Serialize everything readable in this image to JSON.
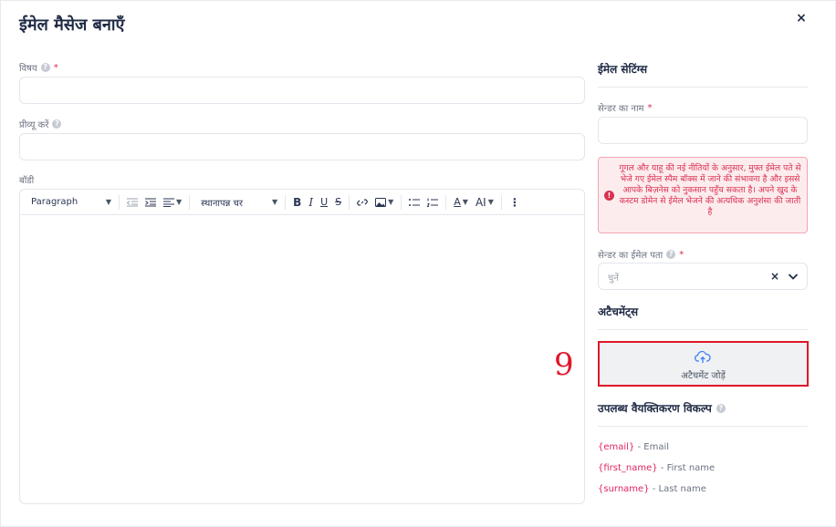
{
  "modal": {
    "title": "ईमेल मैसेज बनाएँ",
    "close_glyph": "×"
  },
  "form": {
    "subject_label": "विषय",
    "subject_value": "",
    "preview_label": "प्रीव्यू करें",
    "preview_value": "",
    "body_label": "बॉडी",
    "required_mark": "*"
  },
  "toolbar": {
    "paragraph_select": "Paragraph",
    "font_select": "स्थानापन्न चर",
    "bold": "B",
    "italic": "I",
    "underline": "U",
    "strike": "S",
    "font_color": "A",
    "ai_button": "AI",
    "more": "⋮"
  },
  "settings": {
    "title": "ईमेल सेटिंग्स",
    "sender_name_label": "सेन्डर का नाम",
    "sender_name_value": "",
    "warning_text": "गूगल और याहू की नई नीतियों के अनुसार, मुफ्त ईमेल पते से भेजे गए ईमेल स्पैम बॉक्स में जाने की संभावना है और इससे आपके बिज़नेस को नुकसान पहुँच सकता है। अपने खुद के कस्टम डोमेन से ईमेल भेजने की अत्यधिक अनुशंसा की जाती है",
    "sender_email_label": "सेन्डर का ईमेल पता",
    "sender_email_placeholder": "चुनें",
    "clear_glyph": "×"
  },
  "attachments": {
    "title": "अटैचमेंट्स",
    "add_label": "अटैचमेंट जोड़ें"
  },
  "annotation": {
    "step_number": "9"
  },
  "personalization": {
    "title": "उपलब्ध वैयक्तिकरण विकल्प",
    "variables": [
      {
        "tag": "{email}",
        "desc": " - Email"
      },
      {
        "tag": "{first_name}",
        "desc": " - First name"
      },
      {
        "tag": "{surname}",
        "desc": " - Last name"
      }
    ]
  },
  "colors": {
    "accent_red": "#e0172a",
    "warning_red": "#d93050",
    "tag_pink": "#e0245e",
    "text_dark": "#1f2a44",
    "link_blue": "#3b82f6"
  }
}
